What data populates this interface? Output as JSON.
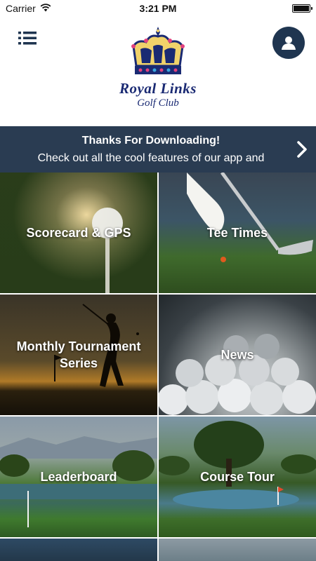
{
  "status_bar": {
    "carrier": "Carrier",
    "time": "3:21 PM"
  },
  "header": {
    "logo_line1": "Royal Links",
    "logo_line2": "Golf Club",
    "icons": {
      "menu": "hamburger-menu-icon",
      "profile": "user-profile-icon",
      "logo": "crown-icon"
    }
  },
  "banner": {
    "title": "Thanks For Downloading!",
    "message": "Check out all the cool features of our app and",
    "icon": "chevron-right-icon"
  },
  "tiles": [
    {
      "label": "Scorecard & GPS"
    },
    {
      "label": "Tee Times"
    },
    {
      "label": "Monthly Tournament Series"
    },
    {
      "label": "News"
    },
    {
      "label": "Leaderboard"
    },
    {
      "label": "Course Tour"
    }
  ],
  "colors": {
    "header_bg": "#ffffff",
    "banner_bg": "#2a3c52",
    "profile_button_bg": "#1f3550",
    "logo_text": "#1a2a73",
    "menu_icon": "#1f3550",
    "tile_text": "#ffffff"
  }
}
